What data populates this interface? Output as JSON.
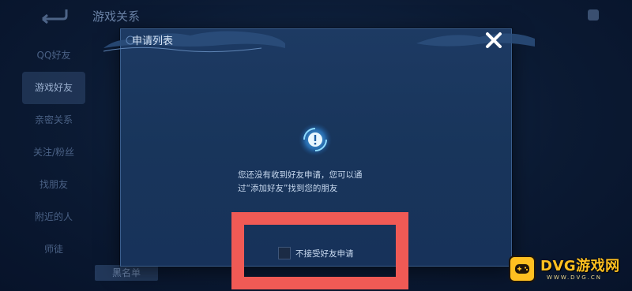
{
  "background": {
    "title": "游戏关系",
    "sidebar": [
      {
        "label": "QQ好友",
        "active": false
      },
      {
        "label": "游戏好友",
        "active": true
      },
      {
        "label": "亲密关系",
        "active": false
      },
      {
        "label": "关注/粉丝",
        "active": false
      },
      {
        "label": "找朋友",
        "active": false
      },
      {
        "label": "附近的人",
        "active": false
      },
      {
        "label": "师徒",
        "active": false
      }
    ],
    "blacklist_label": "黑名单"
  },
  "modal": {
    "title": "申请列表",
    "message_line1": "您还没有收到好友申请，您可以通",
    "message_line2": "过“添加好友”找到您的朋友",
    "checkbox_label": "不接受好友申请",
    "checkbox_checked": false
  },
  "watermark": {
    "text": "DVG游戏网",
    "domain": "WWW.DVG.CN"
  },
  "colors": {
    "annotation": "#f05a55",
    "accent": "#4fb3ff",
    "watermark": "#ffc021"
  }
}
